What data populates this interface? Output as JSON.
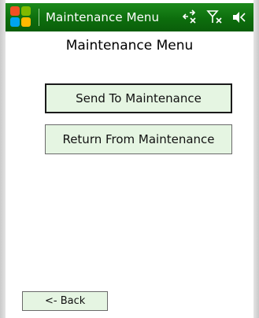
{
  "title_bar": {
    "title": "Maintenance Menu",
    "icons": [
      "windows-start-icon",
      "connectivity-icon",
      "signal-off-icon",
      "volume-icon"
    ]
  },
  "page": {
    "title": "Maintenance Menu"
  },
  "buttons": {
    "send": "Send To Maintenance",
    "return": "Return From Maintenance",
    "back": "<- Back"
  },
  "colors": {
    "title_bar": "#0d6e0d",
    "button_fill": "#e5f5e2"
  }
}
